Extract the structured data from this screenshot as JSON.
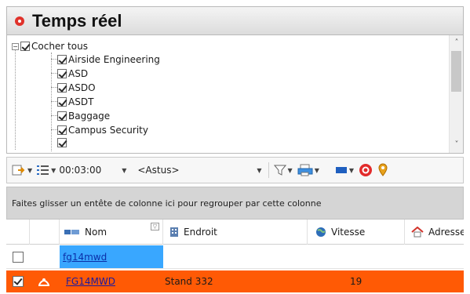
{
  "panel": {
    "title": "Temps réel"
  },
  "tree": {
    "root_label": "Cocher tous",
    "items": [
      {
        "label": "Airside Engineering",
        "checked": true
      },
      {
        "label": "ASD",
        "checked": true
      },
      {
        "label": "ASDO",
        "checked": true
      },
      {
        "label": "ASDT",
        "checked": true
      },
      {
        "label": "Baggage",
        "checked": true
      },
      {
        "label": "Campus Security",
        "checked": true
      }
    ]
  },
  "toolbar": {
    "time_value": "00:03:00",
    "filter_value": "<Astus>",
    "icons": [
      "export-icon",
      "list-view-icon",
      "filter-icon",
      "printer-icon",
      "display-icon",
      "no-entry-icon",
      "map-pin-icon"
    ]
  },
  "group_hint": "Faites glisser un entête de colonne ici pour regrouper par cette colonne",
  "grid": {
    "columns": [
      {
        "label": "Nom",
        "icon": "vehicle-icon"
      },
      {
        "label": "Endroit",
        "icon": "building-icon"
      },
      {
        "label": "Vitesse",
        "icon": "globe-icon"
      },
      {
        "label": "Adresse",
        "icon": "home-icon"
      }
    ],
    "filter_row": {
      "nom_value": "fg14mwd"
    },
    "rows": [
      {
        "nom": "FG14MWD",
        "endroit": "Stand 332",
        "vitesse": "19",
        "checked": true,
        "highlight": "#ff5a05"
      }
    ]
  },
  "colors": {
    "title_dot": "#e0322b",
    "selected_row": "#ff5a05",
    "edit_cell": "#39a7ff"
  }
}
